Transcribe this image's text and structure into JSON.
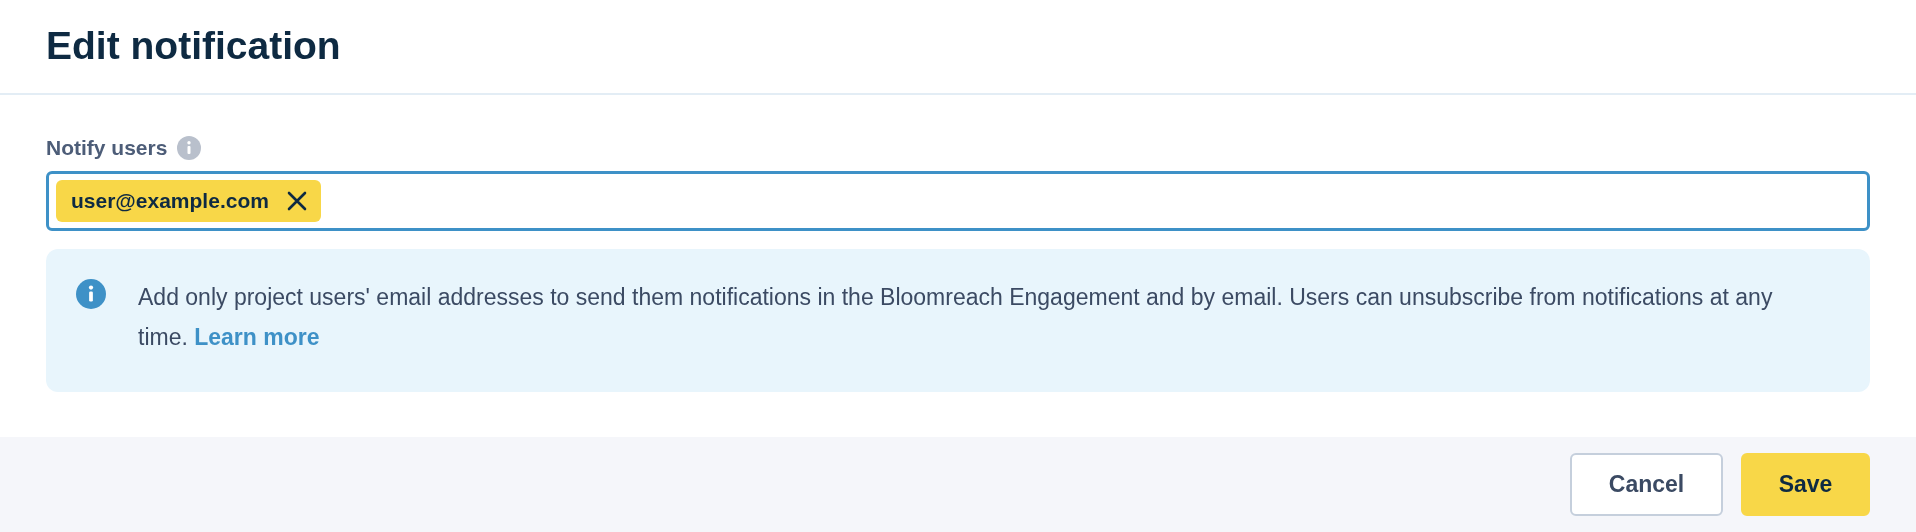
{
  "dialog": {
    "title": "Edit notification"
  },
  "field": {
    "label": "Notify users",
    "tags": [
      "user@example.com"
    ]
  },
  "info": {
    "text": "Add only project users' email addresses to send them notifications in the Bloomreach Engagement and by email. Users can unsubscribe from notifications at any time.",
    "link": "Learn more"
  },
  "buttons": [
    {
      "label": "Cancel",
      "kind": "secondary"
    },
    {
      "label": "Save",
      "kind": "primary"
    }
  ]
}
